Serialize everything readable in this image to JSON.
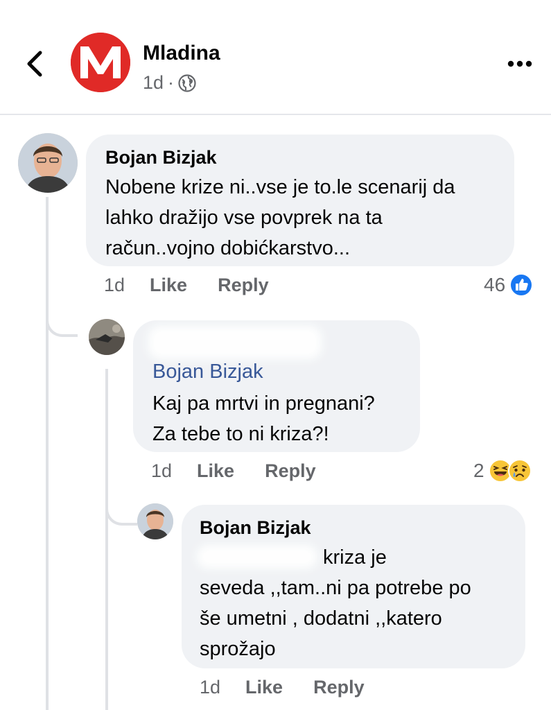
{
  "post": {
    "page_name": "Mladina",
    "time": "1d",
    "separator": "·"
  },
  "comments": [
    {
      "author": "Bojan Bizjak",
      "text_lines": [
        "Nobene krize ni..vse je to.le scenarij da",
        "lahko dražijo vse povprek na ta",
        "račun..vojno dobićkarstvo..."
      ],
      "time": "1d",
      "like_label": "Like",
      "reply_label": "Reply",
      "reaction_count": "46"
    },
    {
      "author": "",
      "mention": "Bojan Bizjak",
      "text_lines": [
        "Kaj pa mrtvi in pregnani?",
        "Za tebe to ni kriza?!"
      ],
      "time": "1d",
      "like_label": "Like",
      "reply_label": "Reply",
      "reaction_count": "2"
    },
    {
      "author": "Bojan Bizjak",
      "text_lines": [
        "kriza je",
        "seveda ,,tam..ni pa potrebe po",
        "še umetni , dodatni ,,katero",
        "sprožajo"
      ],
      "time": "1d",
      "like_label": "Like",
      "reply_label": "Reply"
    }
  ],
  "icons": {
    "back": "chevron-left-icon",
    "more": "more-horizontal-icon",
    "audience": "globe-icon",
    "like_reaction": "like-reaction-icon",
    "haha_reaction": "haha-reaction-icon",
    "sad_reaction": "sad-reaction-icon"
  },
  "colors": {
    "brand_red": "#e02a27",
    "like_blue": "#1877f2",
    "mention_blue": "#385898",
    "bubble_gray": "#f0f2f5",
    "muted_text": "#65676b"
  }
}
